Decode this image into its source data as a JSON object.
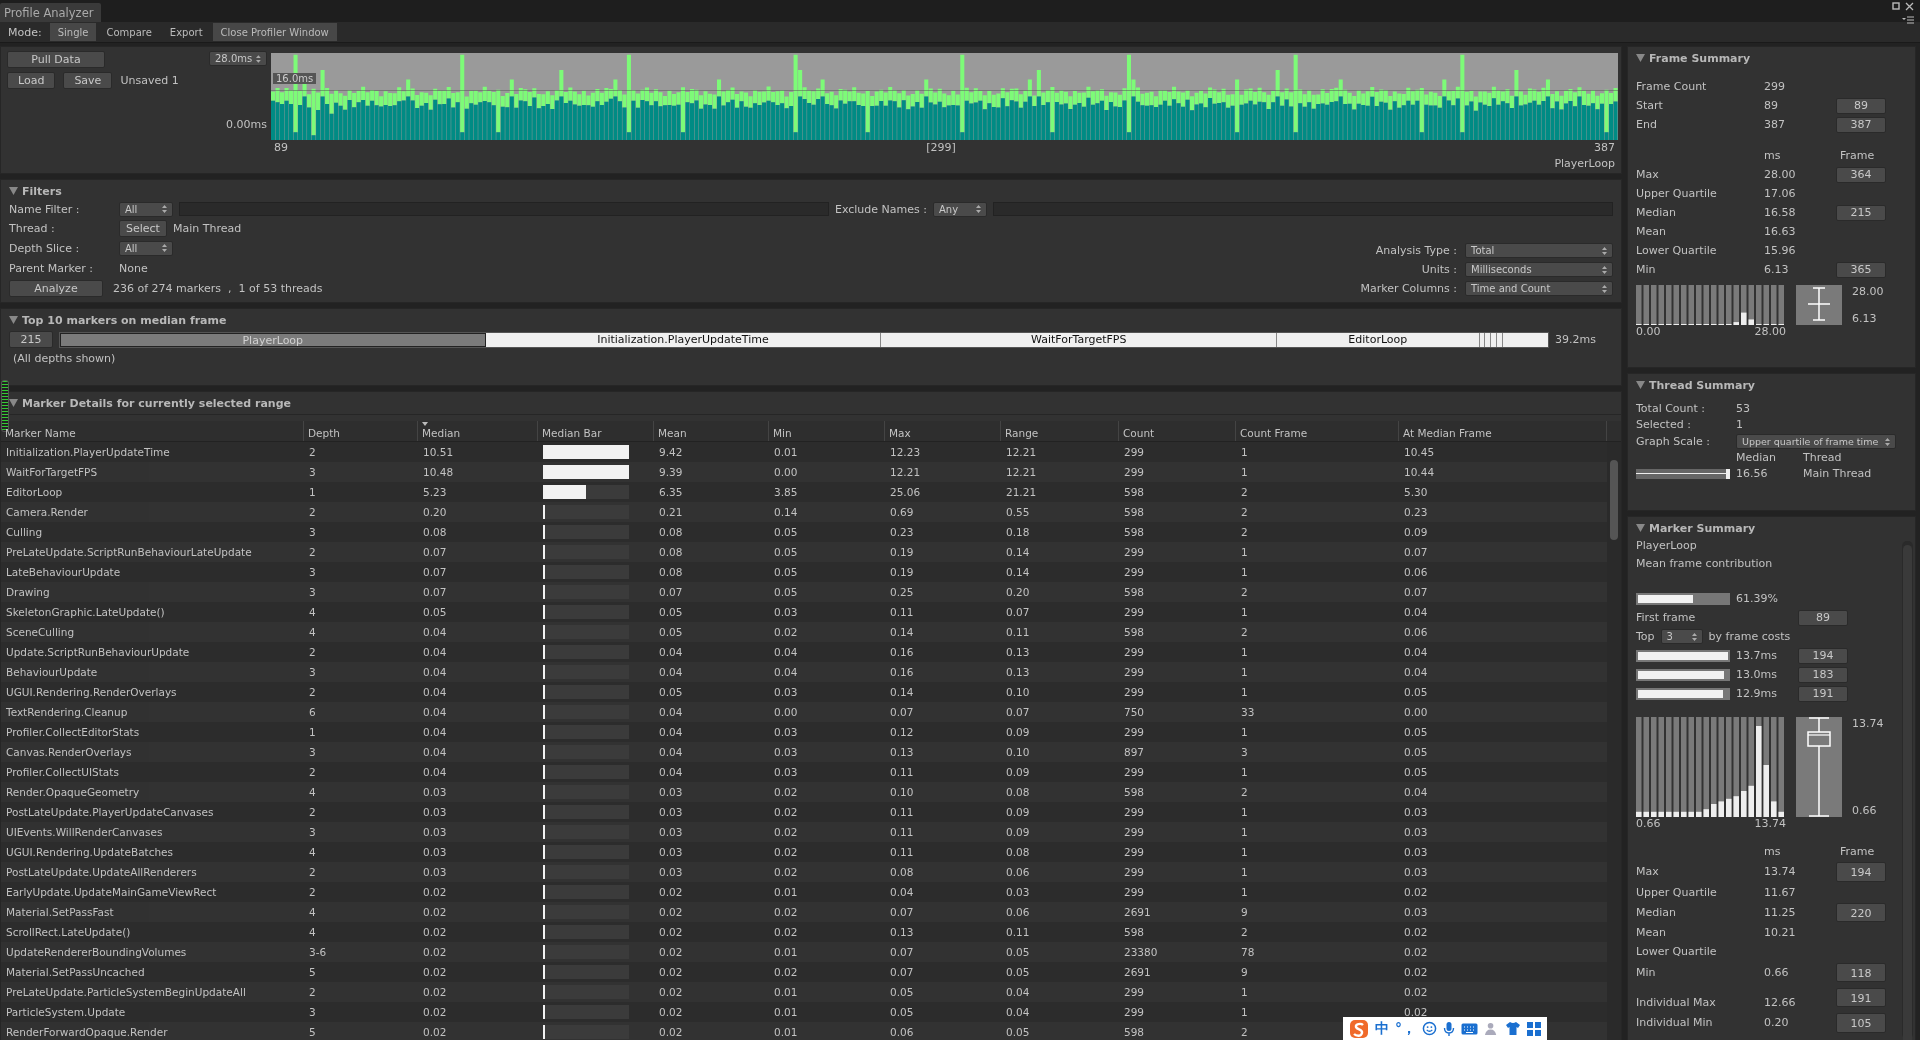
{
  "window": {
    "tab": "Profile Analyzer"
  },
  "mode_bar": {
    "label": "Mode:",
    "modes": [
      {
        "label": "Single",
        "selected": true
      },
      {
        "label": "Compare",
        "selected": false
      },
      {
        "label": "Export",
        "selected": false
      }
    ],
    "close_button": "Close Profiler Window"
  },
  "data_panel": {
    "pull_button": "Pull Data",
    "load_button": "Load",
    "save_button": "Save",
    "file_name": "Unsaved 1",
    "scale_dropdown": "28.0ms",
    "threshold_label": "16.0ms",
    "y_min_label": "0.00ms",
    "x_start": "89",
    "x_selected": "[299]",
    "x_end": "387",
    "marker": "PlayerLoop"
  },
  "filters": {
    "title": "Filters",
    "name_filter": {
      "label": "Name Filter :",
      "dropdown": "All"
    },
    "exclude_names": {
      "label": "Exclude Names :",
      "dropdown": "Any"
    },
    "thread": {
      "label": "Thread :",
      "button": "Select",
      "value": "Main Thread"
    },
    "depth_slice": {
      "label": "Depth Slice :",
      "dropdown": "All"
    },
    "parent_marker": {
      "label": "Parent Marker :",
      "value": "None"
    },
    "analyze_button": "Analyze",
    "summary": "236 of 274 markers  ,  1 of 53 threads",
    "options": [
      {
        "label": "Analysis Type :",
        "value": "Total"
      },
      {
        "label": "Units :",
        "value": "Milliseconds"
      },
      {
        "label": "Marker Columns :",
        "value": "Time and Count"
      }
    ]
  },
  "top_markers": {
    "title": "Top 10 markers on median frame",
    "frame_button": "215",
    "total": "39.2ms",
    "note": "(All depths shown)",
    "segments": [
      {
        "label": "PlayerLoop",
        "selected": true
      },
      {
        "label": "Initialization.PlayerUpdateTime",
        "selected": false
      },
      {
        "label": "WaitForTargetFPS",
        "selected": false
      },
      {
        "label": "EditorLoop",
        "selected": false
      },
      {
        "selected": false
      },
      {
        "selected": false
      },
      {
        "selected": false
      },
      {
        "selected": false
      }
    ]
  },
  "marker_details": {
    "title": "Marker Details for currently selected range",
    "columns": [
      {
        "label": "Marker Name",
        "sorted": false
      },
      {
        "label": "Depth",
        "sorted": false
      },
      {
        "label": "Median",
        "sorted": true
      },
      {
        "label": "Median Bar",
        "sorted": false
      },
      {
        "label": "Mean",
        "sorted": false
      },
      {
        "label": "Min",
        "sorted": false
      },
      {
        "label": "Max",
        "sorted": false
      },
      {
        "label": "Range",
        "sorted": false
      },
      {
        "label": "Count",
        "sorted": false
      },
      {
        "label": "Count Frame",
        "sorted": false
      },
      {
        "label": "At Median Frame",
        "sorted": false
      }
    ],
    "rows": [
      {
        "name": "Initialization.PlayerUpdateTime",
        "depth": "2",
        "median": "10.51",
        "level": 1.0,
        "mean": "9.42",
        "min": "0.01",
        "max": "12.23",
        "range": "12.21",
        "count": "299",
        "count_frame": "1",
        "at_median_frame": "10.45"
      },
      {
        "name": "WaitForTargetFPS",
        "depth": "3",
        "median": "10.48",
        "level": 0.997,
        "mean": "9.39",
        "min": "0.00",
        "max": "12.21",
        "range": "12.21",
        "count": "299",
        "count_frame": "1",
        "at_median_frame": "10.44"
      },
      {
        "name": "EditorLoop",
        "depth": "1",
        "median": "5.23",
        "level": 0.498,
        "mean": "6.35",
        "min": "3.85",
        "max": "25.06",
        "range": "21.21",
        "count": "598",
        "count_frame": "2",
        "at_median_frame": "5.30"
      },
      {
        "name": "Camera.Render",
        "depth": "2",
        "median": "0.20",
        "level": 0.019,
        "mean": "0.21",
        "min": "0.14",
        "max": "0.69",
        "range": "0.55",
        "count": "598",
        "count_frame": "2",
        "at_median_frame": "0.23"
      },
      {
        "name": "Culling",
        "depth": "3",
        "median": "0.08",
        "level": 0.008,
        "mean": "0.08",
        "min": "0.05",
        "max": "0.23",
        "range": "0.18",
        "count": "598",
        "count_frame": "2",
        "at_median_frame": "0.09"
      },
      {
        "name": "PreLateUpdate.ScriptRunBehaviourLateUpdate",
        "depth": "2",
        "median": "0.07",
        "level": 0.007,
        "mean": "0.08",
        "min": "0.05",
        "max": "0.19",
        "range": "0.14",
        "count": "299",
        "count_frame": "1",
        "at_median_frame": "0.07"
      },
      {
        "name": "LateBehaviourUpdate",
        "depth": "3",
        "median": "0.07",
        "level": 0.007,
        "mean": "0.08",
        "min": "0.05",
        "max": "0.19",
        "range": "0.14",
        "count": "299",
        "count_frame": "1",
        "at_median_frame": "0.06"
      },
      {
        "name": "Drawing",
        "depth": "3",
        "median": "0.07",
        "level": 0.007,
        "mean": "0.07",
        "min": "0.05",
        "max": "0.25",
        "range": "0.20",
        "count": "598",
        "count_frame": "2",
        "at_median_frame": "0.07"
      },
      {
        "name": "SkeletonGraphic.LateUpdate()",
        "depth": "4",
        "median": "0.05",
        "level": 0.005,
        "mean": "0.05",
        "min": "0.03",
        "max": "0.11",
        "range": "0.07",
        "count": "299",
        "count_frame": "1",
        "at_median_frame": "0.04"
      },
      {
        "name": "SceneCulling",
        "depth": "4",
        "median": "0.04",
        "level": 0.004,
        "mean": "0.05",
        "min": "0.02",
        "max": "0.14",
        "range": "0.11",
        "count": "598",
        "count_frame": "2",
        "at_median_frame": "0.06"
      },
      {
        "name": "Update.ScriptRunBehaviourUpdate",
        "depth": "2",
        "median": "0.04",
        "level": 0.004,
        "mean": "0.04",
        "min": "0.04",
        "max": "0.16",
        "range": "0.13",
        "count": "299",
        "count_frame": "1",
        "at_median_frame": "0.04"
      },
      {
        "name": "BehaviourUpdate",
        "depth": "3",
        "median": "0.04",
        "level": 0.004,
        "mean": "0.04",
        "min": "0.04",
        "max": "0.16",
        "range": "0.13",
        "count": "299",
        "count_frame": "1",
        "at_median_frame": "0.04"
      },
      {
        "name": "UGUI.Rendering.RenderOverlays",
        "depth": "2",
        "median": "0.04",
        "level": 0.004,
        "mean": "0.05",
        "min": "0.03",
        "max": "0.14",
        "range": "0.10",
        "count": "299",
        "count_frame": "1",
        "at_median_frame": "0.05"
      },
      {
        "name": "TextRendering.Cleanup",
        "depth": "6",
        "median": "0.04",
        "level": 0.004,
        "mean": "0.04",
        "min": "0.00",
        "max": "0.07",
        "range": "0.07",
        "count": "750",
        "count_frame": "33",
        "at_median_frame": "0.00"
      },
      {
        "name": "Profiler.CollectEditorStats",
        "depth": "1",
        "median": "0.04",
        "level": 0.004,
        "mean": "0.04",
        "min": "0.03",
        "max": "0.12",
        "range": "0.09",
        "count": "299",
        "count_frame": "1",
        "at_median_frame": "0.05"
      },
      {
        "name": "Canvas.RenderOverlays",
        "depth": "3",
        "median": "0.04",
        "level": 0.004,
        "mean": "0.04",
        "min": "0.03",
        "max": "0.13",
        "range": "0.10",
        "count": "897",
        "count_frame": "3",
        "at_median_frame": "0.05"
      },
      {
        "name": "Profiler.CollectUIStats",
        "depth": "2",
        "median": "0.04",
        "level": 0.004,
        "mean": "0.04",
        "min": "0.03",
        "max": "0.11",
        "range": "0.09",
        "count": "299",
        "count_frame": "1",
        "at_median_frame": "0.05"
      },
      {
        "name": "Render.OpaqueGeometry",
        "depth": "4",
        "median": "0.03",
        "level": 0.003,
        "mean": "0.03",
        "min": "0.02",
        "max": "0.10",
        "range": "0.08",
        "count": "598",
        "count_frame": "2",
        "at_median_frame": "0.04"
      },
      {
        "name": "PostLateUpdate.PlayerUpdateCanvases",
        "depth": "2",
        "median": "0.03",
        "level": 0.003,
        "mean": "0.03",
        "min": "0.02",
        "max": "0.11",
        "range": "0.09",
        "count": "299",
        "count_frame": "1",
        "at_median_frame": "0.03"
      },
      {
        "name": "UIEvents.WillRenderCanvases",
        "depth": "3",
        "median": "0.03",
        "level": 0.003,
        "mean": "0.03",
        "min": "0.02",
        "max": "0.11",
        "range": "0.09",
        "count": "299",
        "count_frame": "1",
        "at_median_frame": "0.03"
      },
      {
        "name": "UGUI.Rendering.UpdateBatches",
        "depth": "4",
        "median": "0.03",
        "level": 0.003,
        "mean": "0.03",
        "min": "0.02",
        "max": "0.11",
        "range": "0.08",
        "count": "299",
        "count_frame": "1",
        "at_median_frame": "0.03"
      },
      {
        "name": "PostLateUpdate.UpdateAllRenderers",
        "depth": "2",
        "median": "0.03",
        "level": 0.003,
        "mean": "0.03",
        "min": "0.02",
        "max": "0.08",
        "range": "0.06",
        "count": "299",
        "count_frame": "1",
        "at_median_frame": "0.03"
      },
      {
        "name": "EarlyUpdate.UpdateMainGameViewRect",
        "depth": "2",
        "median": "0.02",
        "level": 0.002,
        "mean": "0.02",
        "min": "0.01",
        "max": "0.04",
        "range": "0.03",
        "count": "299",
        "count_frame": "1",
        "at_median_frame": "0.02"
      },
      {
        "name": "Material.SetPassFast",
        "depth": "4",
        "median": "0.02",
        "level": 0.002,
        "mean": "0.02",
        "min": "0.02",
        "max": "0.07",
        "range": "0.06",
        "count": "2691",
        "count_frame": "9",
        "at_median_frame": "0.03"
      },
      {
        "name": "ScrollRect.LateUpdate()",
        "depth": "4",
        "median": "0.02",
        "level": 0.002,
        "mean": "0.02",
        "min": "0.02",
        "max": "0.13",
        "range": "0.11",
        "count": "598",
        "count_frame": "2",
        "at_median_frame": "0.02"
      },
      {
        "name": "UpdateRendererBoundingVolumes",
        "depth": "3-6",
        "median": "0.02",
        "level": 0.002,
        "mean": "0.02",
        "min": "0.01",
        "max": "0.07",
        "range": "0.05",
        "count": "23380",
        "count_frame": "78",
        "at_median_frame": "0.02"
      },
      {
        "name": "Material.SetPassUncached",
        "depth": "5",
        "median": "0.02",
        "level": 0.002,
        "mean": "0.02",
        "min": "0.02",
        "max": "0.07",
        "range": "0.05",
        "count": "2691",
        "count_frame": "9",
        "at_median_frame": "0.02"
      },
      {
        "name": "PreLateUpdate.ParticleSystemBeginUpdateAll",
        "depth": "2",
        "median": "0.02",
        "level": 0.002,
        "mean": "0.02",
        "min": "0.01",
        "max": "0.05",
        "range": "0.04",
        "count": "299",
        "count_frame": "1",
        "at_median_frame": "0.02"
      },
      {
        "name": "ParticleSystem.Update",
        "depth": "3",
        "median": "0.02",
        "level": 0.002,
        "mean": "0.02",
        "min": "0.01",
        "max": "0.05",
        "range": "0.04",
        "count": "299",
        "count_frame": "1",
        "at_median_frame": "0.02"
      },
      {
        "name": "RenderForwardOpaque.Render",
        "depth": "5",
        "median": "0.02",
        "level": 0.002,
        "mean": "0.02",
        "min": "0.01",
        "max": "0.06",
        "range": "0.05",
        "count": "598",
        "count_frame": "2"
      }
    ]
  },
  "frame_summary": {
    "title": "Frame Summary",
    "counts": [
      {
        "label": "Frame Count",
        "value": "299"
      },
      {
        "label": "Start",
        "value": "89",
        "frame": "89"
      },
      {
        "label": "End",
        "value": "387",
        "frame": "387"
      }
    ],
    "ms_header": "ms",
    "frame_header": "Frame",
    "stats": [
      {
        "label": "Max",
        "value": "28.00",
        "frame": "364"
      },
      {
        "label": "Upper Quartile",
        "value": "17.06"
      },
      {
        "label": "Median",
        "value": "16.58",
        "frame": "215"
      },
      {
        "label": "Mean",
        "value": "16.63"
      },
      {
        "label": "Lower Quartile",
        "value": "15.96"
      },
      {
        "label": "Min",
        "value": "6.13",
        "frame": "365"
      }
    ],
    "hist_min": "0.00",
    "hist_max": "28.00",
    "box_max": "28.00",
    "box_min": "6.13"
  },
  "thread_summary": {
    "title": "Thread Summary",
    "total_label": "Total Count :",
    "total": "53",
    "selected_label": "Selected :",
    "selected_count": "1",
    "scale_label": "Graph Scale :",
    "scale": "Upper quartile of frame time",
    "median_header": "Median",
    "thread_header": "Thread",
    "threads": [
      {
        "level": 1.0,
        "median": "16.56",
        "name": "Main Thread"
      }
    ]
  },
  "marker_summary": {
    "title": "Marker Summary",
    "marker": "PlayerLoop",
    "contribution_label": "Mean frame contribution",
    "contribution": {
      "level": 0.61,
      "value": "61.39%"
    },
    "first_frame_label": "First frame",
    "first_frame": "89",
    "top_label": "Top",
    "top_count": "3",
    "top_suffix": "by frame costs",
    "top_frames": [
      {
        "level": 1.0,
        "value": "13.7ms",
        "frame": "194"
      },
      {
        "level": 0.95,
        "value": "13.0ms",
        "frame": "183"
      },
      {
        "level": 0.94,
        "value": "12.9ms",
        "frame": "191"
      }
    ],
    "hist_min": "0.66",
    "hist_max": "13.74",
    "box_max": "13.74",
    "box_min": "0.66",
    "ms_header": "ms",
    "frame_header": "Frame",
    "stats": [
      {
        "label": "Max",
        "value": "13.74",
        "frame": "194"
      },
      {
        "label": "Upper Quartile",
        "value": "11.67"
      },
      {
        "label": "Median",
        "value": "11.25",
        "frame": "220"
      },
      {
        "label": "Mean",
        "value": "10.21"
      },
      {
        "label": "Lower Quartile"
      },
      {
        "label": "Min",
        "value": "0.66",
        "frame": "118"
      },
      {
        "label": "Individual Max",
        "value": "12.66",
        "frame": "191",
        "gap": true
      },
      {
        "label": "Individual Min",
        "value": "0.20",
        "frame": "105"
      }
    ]
  },
  "ime_toolbar": {
    "language": "中",
    "punctuation": "°，"
  }
}
